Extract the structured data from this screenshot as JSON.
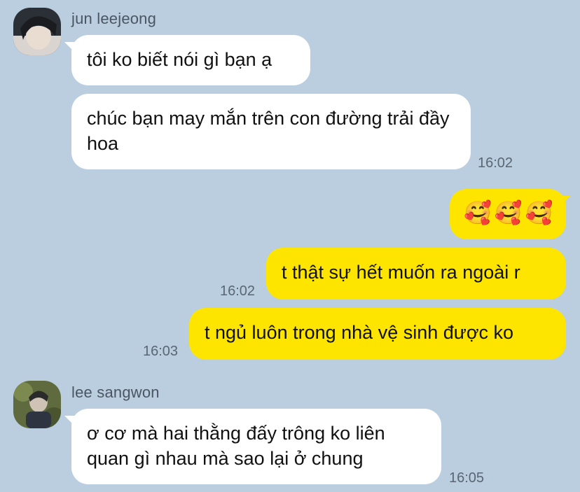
{
  "conversation": {
    "group1": {
      "sender": "jun leejeong",
      "messages": [
        "tôi ko biết nói gì bạn ạ",
        "chúc bạn may mắn trên con đường trải đầy hoa"
      ],
      "time": "16:02"
    },
    "mine": {
      "emoji_message": [
        "🥰",
        "🥰",
        "🥰"
      ],
      "msg1": "t thật sự hết muốn ra ngoài r",
      "time1": "16:02",
      "msg2": "t ngủ luôn trong nhà vệ sinh được ko",
      "time2": "16:03"
    },
    "group2": {
      "sender": "lee sangwon",
      "message": "ơ cơ mà hai thằng đấy trông ko liên quan gì nhau mà sao lại ở chung",
      "time": "16:05"
    }
  },
  "colors": {
    "background": "#bacee0",
    "incoming_bubble": "#ffffff",
    "outgoing_bubble": "#fee500"
  }
}
